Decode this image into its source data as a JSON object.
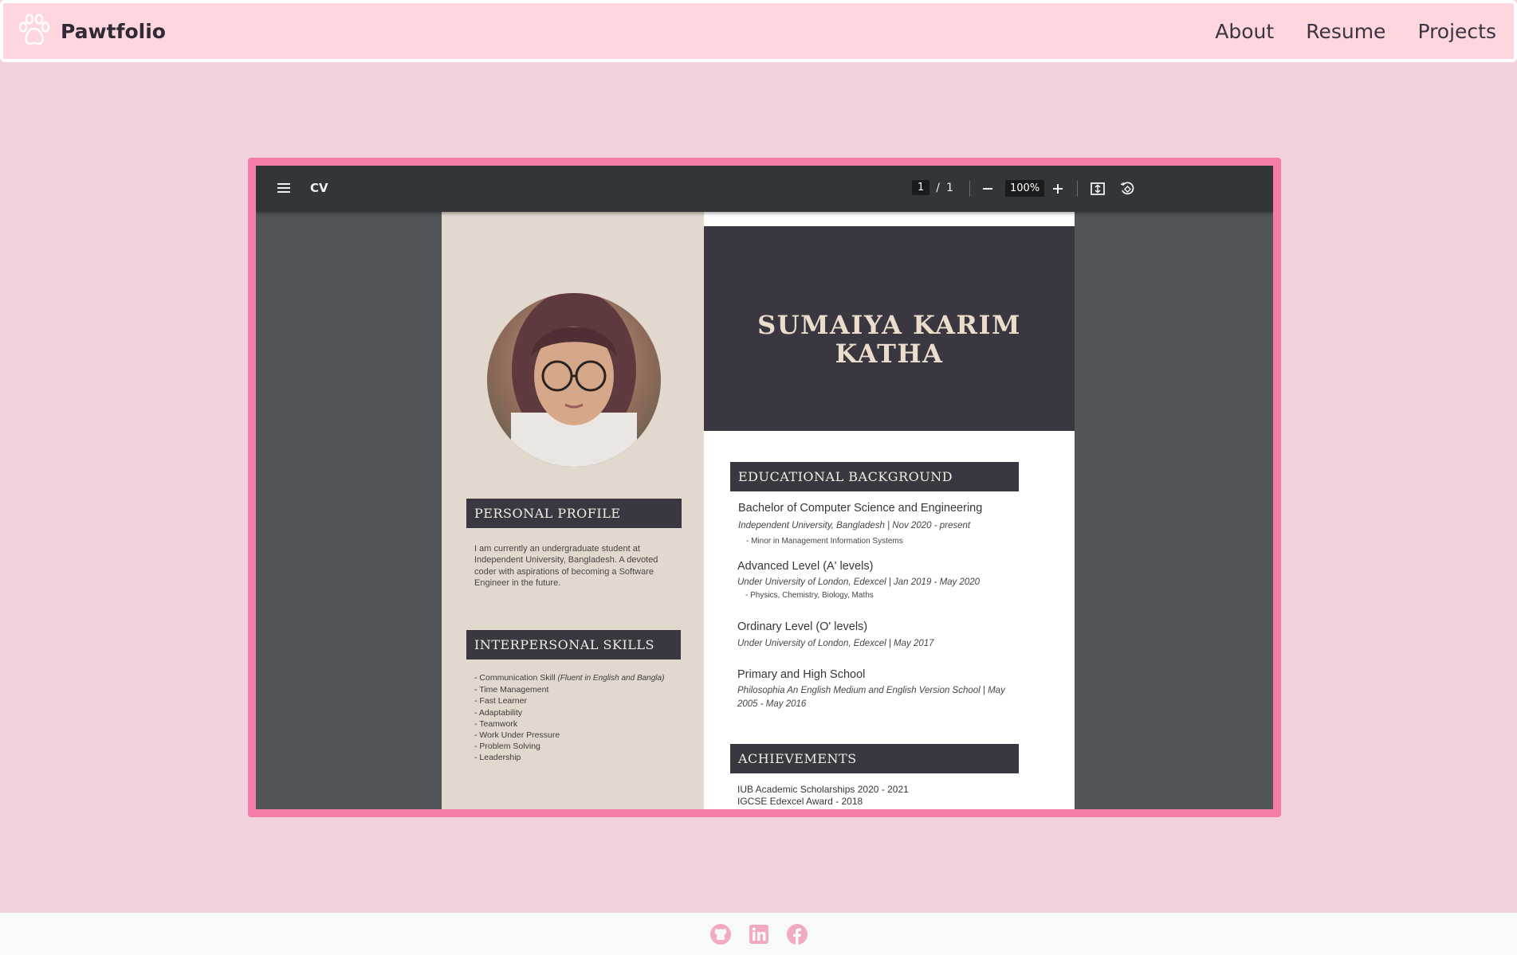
{
  "navbar": {
    "brand": "Pawtfolio",
    "links": [
      "About",
      "Resume",
      "Projects"
    ]
  },
  "viewer": {
    "title": "CV",
    "page_current": "1",
    "page_separator": "/",
    "page_total": "1",
    "zoom": "100%",
    "icons": [
      "menu-icon",
      "zoom-out-icon",
      "zoom-in-icon",
      "fit-page-icon",
      "rotate-icon"
    ]
  },
  "resume": {
    "name_line1": "SUMAIYA KARIM",
    "name_line2": "KATHA",
    "personal_profile": {
      "heading": "PERSONAL PROFILE",
      "text": "I am currently an undergraduate student at Independent University, Bangladesh. A devoted coder with aspirations of becoming a Software Engineer in the future."
    },
    "interpersonal_skills": {
      "heading": "INTERPERSONAL SKILLS",
      "first_label": "- Communication Skill ",
      "first_note": "(Fluent in English and Bangla)",
      "items": [
        "- Time Management",
        "- Fast Learner",
        "- Adaptability",
        "- Teamwork",
        "- Work Under Pressure",
        "- Problem Solving",
        "- Leadership"
      ]
    },
    "education": {
      "heading": "EDUCATIONAL BACKGROUND",
      "entries": [
        {
          "title": "Bachelor of Computer Science and Engineering",
          "sub": "Independent University, Bangladesh | Nov 2020 - present",
          "note": "- Minor in  Management Information Systems"
        },
        {
          "title": "Advanced Level (A' levels)",
          "sub": "Under University of London, Edexcel | Jan 2019 - May 2020",
          "note": "- Physics, Chemistry, Biology, Maths"
        },
        {
          "title": "Ordinary Level (O' levels)",
          "sub": "Under University of London, Edexcel | May 2017",
          "note": ""
        },
        {
          "title": "Primary and High School",
          "sub": "Philosophia An English Medium and English Version School | May 2005 - May 2016",
          "note": ""
        }
      ]
    },
    "achievements": {
      "heading": "ACHIEVEMENTS",
      "items": [
        "IUB Academic Scholarships 2020 - 2021",
        "IGCSE Edexcel Award - 2018"
      ]
    }
  },
  "footer": {
    "icons": [
      "github-icon",
      "linkedin-icon",
      "facebook-icon"
    ],
    "icon_color": "#f1a9c4"
  },
  "colors": {
    "page_bg": "#f0d1dc",
    "navbar_bg": "#ffd6de",
    "frame_border": "#f77ba9",
    "banner_dark": "#393840",
    "sidebar_beige": "#e2d8cd"
  }
}
